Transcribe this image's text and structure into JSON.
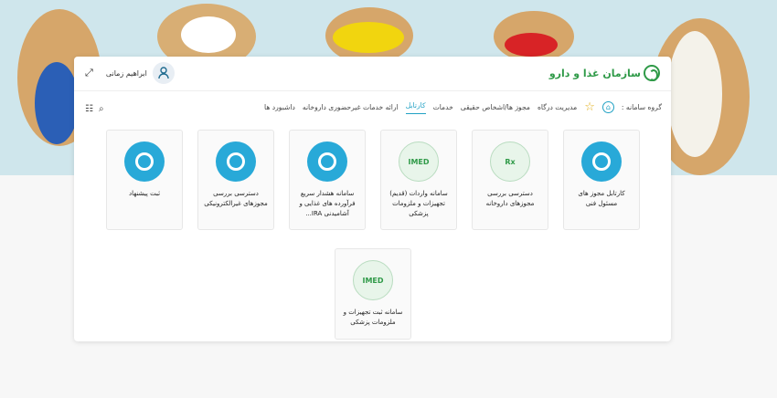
{
  "header": {
    "brand": "سازمان غذا و دارو",
    "user": "ابراهیم زمانی"
  },
  "nav": {
    "group_label": "گروه سامانه :",
    "items": [
      "مدیریت درگاه",
      "مجوز ها/اشخاص حقیقی",
      "خدمات",
      "کارتابل",
      "ارائه خدمات غیرحضوری داروخانه",
      "داشبورد ها"
    ],
    "active": "کارتابل"
  },
  "cards": [
    {
      "label": "کارتابل مجوز های مسئول فنی",
      "icon": "blue-ring-icon"
    },
    {
      "label": "دسترسی بررسی مجوزهای داروخانه",
      "icon": "pharmacy-icon"
    },
    {
      "label": "سامانه واردات (قدیم) تجهیزات و ملزومات پزشکی",
      "icon": "imed-icon"
    },
    {
      "label": "سامانه هشدار سریع فرآورده های غذایی و آشامیدنی IRA...",
      "icon": "blue-ring-icon"
    },
    {
      "label": "دسترسی بررسی مجوزهای غیرالکترونیکی",
      "icon": "blue-ring-icon"
    },
    {
      "label": "ثبت پیشنهاد",
      "icon": "blue-ring-icon"
    },
    {
      "label": "سامانه ثبت تجهیزات و ملزومات پزشکی",
      "icon": "imed-icon"
    }
  ]
}
